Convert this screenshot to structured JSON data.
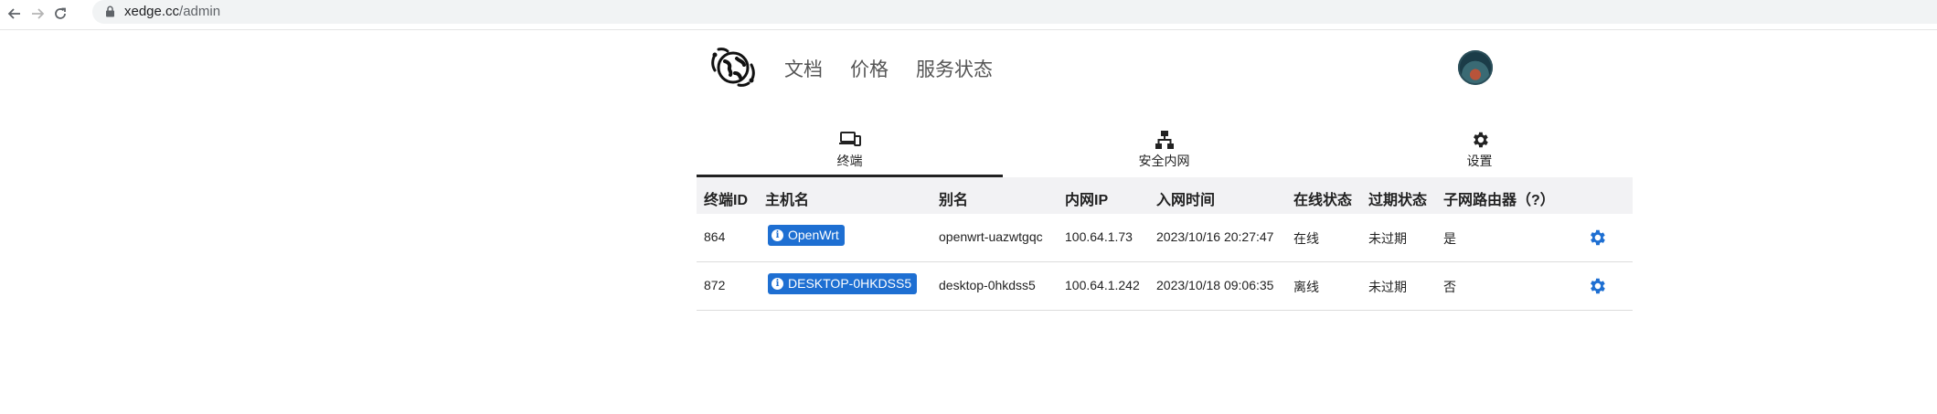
{
  "browser": {
    "url_host": "xedge.cc",
    "url_path": "/admin"
  },
  "nav": {
    "items": [
      {
        "label": "文档"
      },
      {
        "label": "价格"
      },
      {
        "label": "服务状态"
      }
    ]
  },
  "tabs": [
    {
      "label": "终端",
      "icon": "devices-icon",
      "active": true
    },
    {
      "label": "安全内网",
      "icon": "network-icon",
      "active": false
    },
    {
      "label": "设置",
      "icon": "gear-icon",
      "active": false
    }
  ],
  "table": {
    "columns": [
      "终端ID",
      "主机名",
      "别名",
      "内网IP",
      "入网时间",
      "在线状态",
      "过期状态",
      "子网路由器（?）"
    ],
    "rows": [
      {
        "id": "864",
        "hostname": "OpenWrt",
        "alias": "openwrt-uazwtgqc",
        "ip": "100.64.1.73",
        "joined": "2023/10/16 20:27:47",
        "online": "在线",
        "expiry": "未过期",
        "subnet_router": "是"
      },
      {
        "id": "872",
        "hostname": "DESKTOP-0HKDSS5",
        "alias": "desktop-0hkdss5",
        "ip": "100.64.1.242",
        "joined": "2023/10/18 09:06:35",
        "online": "离线",
        "expiry": "未过期",
        "subnet_router": "否"
      }
    ]
  },
  "colors": {
    "accent": "#1e6fd2",
    "header_bg": "#f2f2f4"
  }
}
